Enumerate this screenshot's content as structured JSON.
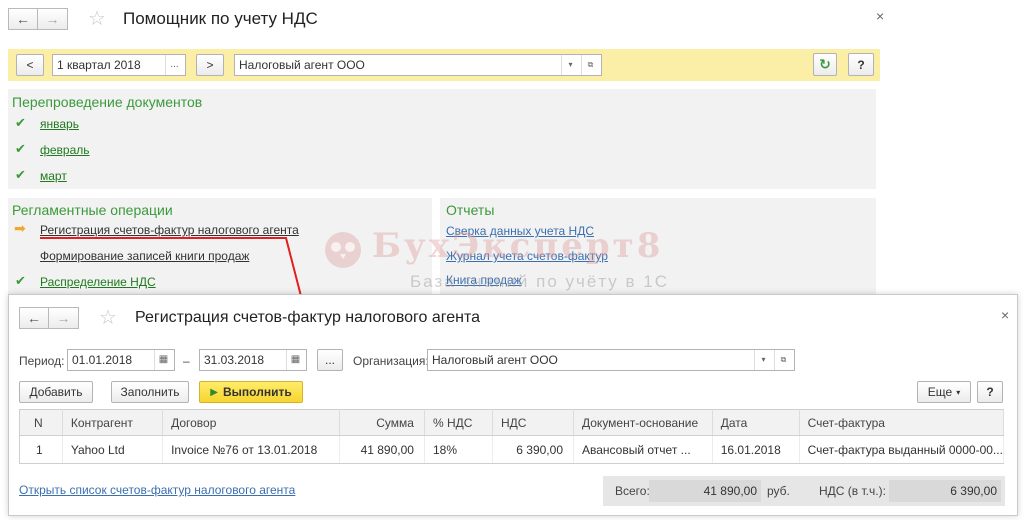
{
  "main_window": {
    "title": "Помощник по учету НДС",
    "nav_back": "←",
    "nav_forward": "→",
    "star": "☆",
    "close": "×"
  },
  "toolbar": {
    "prev": "<",
    "period": "1 квартал 2018",
    "period_select": "...",
    "next": ">",
    "organization": "Налоговый агент ООО",
    "dropdown": "▾",
    "open": "⧉",
    "refresh": "↻",
    "help": "?"
  },
  "reposting": {
    "title": "Перепроведение документов",
    "months": [
      "январь",
      "февраль",
      "март"
    ]
  },
  "regulatory": {
    "title": "Регламентные операции",
    "items": [
      "Регистрация счетов-фактур налогового агента",
      "Формирование записей книги продаж",
      "Распределение НДС"
    ]
  },
  "reports": {
    "title": "Отчеты",
    "items": [
      "Сверка данных учета НДС",
      "Журнал учета счетов-фактур",
      "Книга продаж"
    ]
  },
  "watermark": {
    "title": "БухЭксперт8",
    "subtitle": "База знаний по учёту в 1С"
  },
  "popup": {
    "title": "Регистрация счетов-фактур налогового агента",
    "period_label": "Период:",
    "date_from": "01.01.2018",
    "dash": "–",
    "date_to": "31.03.2018",
    "calendar_icon": "▦",
    "ellipsis": "...",
    "org_label": "Организация:",
    "organization": "Налоговый агент ООО",
    "add_button": "Добавить",
    "fill_button": "Заполнить",
    "run_button": "Выполнить",
    "more_button": "Еще",
    "help": "?",
    "table": {
      "headers": [
        "N",
        "Контрагент",
        "Договор",
        "Сумма",
        "% НДС",
        "НДС",
        "Документ-основание",
        "Дата",
        "Счет-фактура"
      ],
      "rows": [
        [
          "1",
          "Yahoo Ltd",
          "Invoice №76 от 13.01.2018",
          "41 890,00",
          "18%",
          "6 390,00",
          "Авансовый отчет ...",
          "16.01.2018",
          "Счет-фактура выданный 0000-00..."
        ]
      ]
    },
    "open_list_link": "Открыть список счетов-фактур налогового агента",
    "total_label": "Всего:",
    "total_value": "41 890,00",
    "currency": "руб.",
    "vat_label": "НДС (в т.ч.):",
    "vat_value": "6 390,00"
  }
}
